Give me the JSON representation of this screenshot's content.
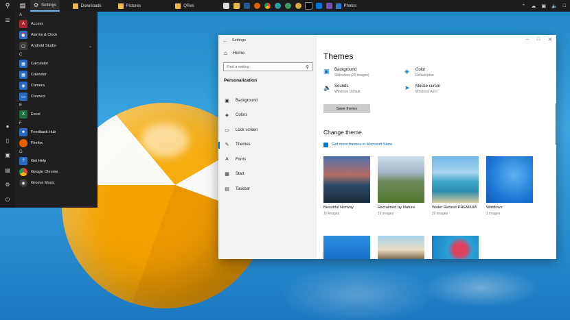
{
  "taskbar": {
    "apps": [
      {
        "label": "Settings",
        "active": true
      },
      {
        "label": "Downloads",
        "active": false
      },
      {
        "label": "Pictures",
        "active": false
      },
      {
        "label": "QRes",
        "active": false
      }
    ],
    "photos_label": "Photos"
  },
  "start_menu": {
    "groups": [
      {
        "letter": "A",
        "apps": [
          {
            "label": "Access",
            "icon": "access-icon",
            "color": "#a4262c"
          },
          {
            "label": "Alarms & Clock",
            "icon": "alarm-clock-icon",
            "color": "#2b6fc4"
          },
          {
            "label": "Android Studio",
            "icon": "folder-icon",
            "color": "#3a3a3a",
            "expandable": true
          }
        ]
      },
      {
        "letter": "C",
        "apps": [
          {
            "label": "Calculator",
            "icon": "calculator-icon",
            "color": "#2a6ac0"
          },
          {
            "label": "Calendar",
            "icon": "calendar-icon",
            "color": "#2a6ac0"
          },
          {
            "label": "Camera",
            "icon": "camera-icon",
            "color": "#2a6ac0"
          },
          {
            "label": "Connect",
            "icon": "connect-icon",
            "color": "#2a6ac0"
          }
        ]
      },
      {
        "letter": "E",
        "apps": [
          {
            "label": "Excel",
            "icon": "excel-icon",
            "color": "#1d6f42"
          }
        ]
      },
      {
        "letter": "F",
        "apps": [
          {
            "label": "Feedback Hub",
            "icon": "feedback-icon",
            "color": "#2a6ac0"
          },
          {
            "label": "Firefox",
            "icon": "firefox-icon",
            "color": "#e66000"
          }
        ]
      },
      {
        "letter": "G",
        "apps": [
          {
            "label": "Get Help",
            "icon": "help-icon",
            "color": "#2a6ac0"
          },
          {
            "label": "Google Chrome",
            "icon": "chrome-icon",
            "color": "#4a8a3a"
          },
          {
            "label": "Groove Music",
            "icon": "music-icon",
            "color": "#3a3a3a"
          }
        ]
      }
    ]
  },
  "settings": {
    "window_title": "Settings",
    "home_label": "Home",
    "search_placeholder": "Find a setting",
    "section_label": "Personalization",
    "nav": [
      {
        "label": "Background",
        "icon": "picture-icon",
        "selected": false
      },
      {
        "label": "Colors",
        "icon": "palette-icon",
        "selected": false
      },
      {
        "label": "Lock screen",
        "icon": "monitor-icon",
        "selected": false
      },
      {
        "label": "Themes",
        "icon": "brush-icon",
        "selected": true
      },
      {
        "label": "Fonts",
        "icon": "font-icon",
        "selected": false
      },
      {
        "label": "Start",
        "icon": "start-icon",
        "selected": false
      },
      {
        "label": "Taskbar",
        "icon": "taskbar-icon",
        "selected": false
      }
    ],
    "page_title": "Themes",
    "options": [
      {
        "title": "Background",
        "value": "Slideshow (20 images)",
        "icon": "picture-icon"
      },
      {
        "title": "Color",
        "value": "Default blue",
        "icon": "palette-icon"
      },
      {
        "title": "Sounds",
        "value": "Windows Default",
        "icon": "speaker-icon"
      },
      {
        "title": "Mouse cursor",
        "value": "Windows Aero",
        "icon": "cursor-icon"
      }
    ],
    "save_button": "Save theme",
    "change_title": "Change theme",
    "store_link": "Get more themes in Microsoft Store",
    "themes": [
      {
        "name": "Beautiful Norway",
        "count": "16 images"
      },
      {
        "name": "Reclaimed by Nature",
        "count": "16 images"
      },
      {
        "name": "Water Retreat PREMIUM",
        "count": "20 images"
      },
      {
        "name": "Windows",
        "count": "1 images"
      }
    ]
  }
}
